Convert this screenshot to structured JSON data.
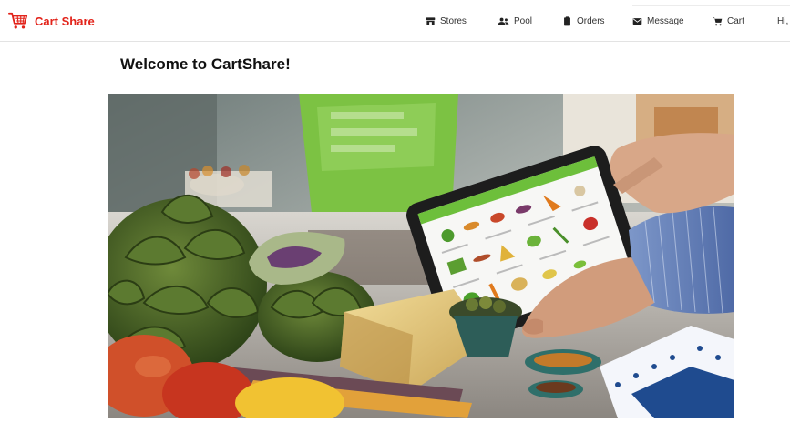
{
  "brand": {
    "name": "Cart Share",
    "icon": "shopping-cart-icon",
    "color": "#e2231a"
  },
  "nav": {
    "items": [
      {
        "label": "Stores",
        "icon": "store-icon"
      },
      {
        "label": "Pool",
        "icon": "users-icon"
      },
      {
        "label": "Orders",
        "icon": "clipboard-icon"
      },
      {
        "label": "Message",
        "icon": "envelope-icon"
      },
      {
        "label": "Cart",
        "icon": "cart-icon"
      }
    ],
    "greeting": "Hi,"
  },
  "main": {
    "title": "Welcome to CartShare!",
    "hero_image": "groceries-tablet-photo"
  },
  "tablet_screen": {
    "header_color": "#6dbf3b"
  }
}
